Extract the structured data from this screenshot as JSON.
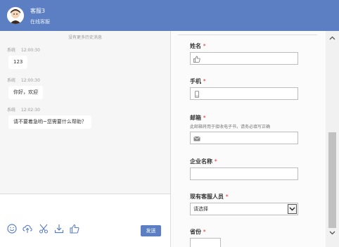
{
  "header": {
    "agent_name": "客服3",
    "agent_status": "在线客服",
    "bg_color": "#5b7fc2"
  },
  "chat": {
    "history_hint": "没有更多历史消息",
    "messages": [
      {
        "sender": "系统",
        "time": "12:00:30",
        "text": "123"
      },
      {
        "sender": "系统",
        "time": "12:00:30",
        "text": "你好，欢迎"
      },
      {
        "sender": "系统",
        "time": "12:02:30",
        "text": "请不要着急哟~您需要什么帮助？"
      }
    ]
  },
  "toolbar": {
    "icons": [
      "emoji-icon",
      "upload-cloud-icon",
      "scissors-icon",
      "download-icon",
      "thumbs-up-icon"
    ],
    "send_label": "发送"
  },
  "form": {
    "required_mark": "*",
    "name_label": "姓名",
    "phone_label": "手机",
    "email_label": "邮箱",
    "email_hint": "此邮箱将用于接收电子书，请务必填写正确",
    "company_label": "企业名称",
    "staff_label": "现有客服人员",
    "staff_selected": "请选择",
    "province_label": "省份"
  }
}
